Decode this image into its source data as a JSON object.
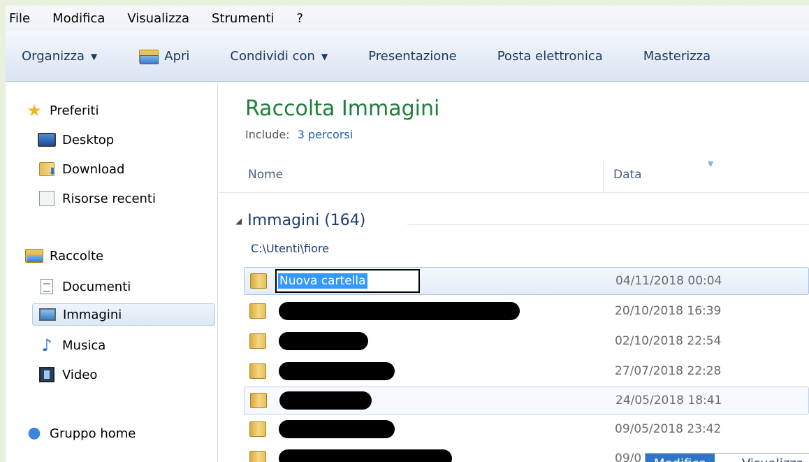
{
  "menubar": {
    "items": [
      "File",
      "Modifica",
      "Visualizza",
      "Strumenti",
      "?"
    ]
  },
  "toolbar": {
    "organize": "Organizza",
    "open": "Apri",
    "share": "Condividi con",
    "slideshow": "Presentazione",
    "email": "Posta elettronica",
    "burn": "Masterizza"
  },
  "nav": {
    "favorites": "Preferiti",
    "desktop": "Desktop",
    "download": "Download",
    "recent": "Risorse recenti",
    "libraries": "Raccolte",
    "documents": "Documenti",
    "pictures": "Immagini",
    "music": "Musica",
    "video": "Video",
    "homegroup": "Gruppo home"
  },
  "main": {
    "title": "Raccolta Immagini",
    "include_label": "Include:",
    "include_link": "3 percorsi",
    "columns": {
      "name": "Nome",
      "date": "Data"
    },
    "group": {
      "title": "Immagini (164)",
      "path": "C:\\Utenti\\fiore"
    },
    "rows": [
      {
        "name": "Nuova cartella",
        "date": "04/11/2018 00:04"
      },
      {
        "name": "",
        "date": "20/10/2018 16:39"
      },
      {
        "name": "",
        "date": "02/10/2018 22:54"
      },
      {
        "name": "",
        "date": "27/07/2018 22:28"
      },
      {
        "name": "",
        "date": "24/05/2018 18:41"
      },
      {
        "name": "",
        "date": "09/05/2018 23:42"
      },
      {
        "name": "",
        "date": "09/0"
      }
    ]
  },
  "popup": {
    "tab_active": "Modifica",
    "tab_other": "Visualizza"
  }
}
